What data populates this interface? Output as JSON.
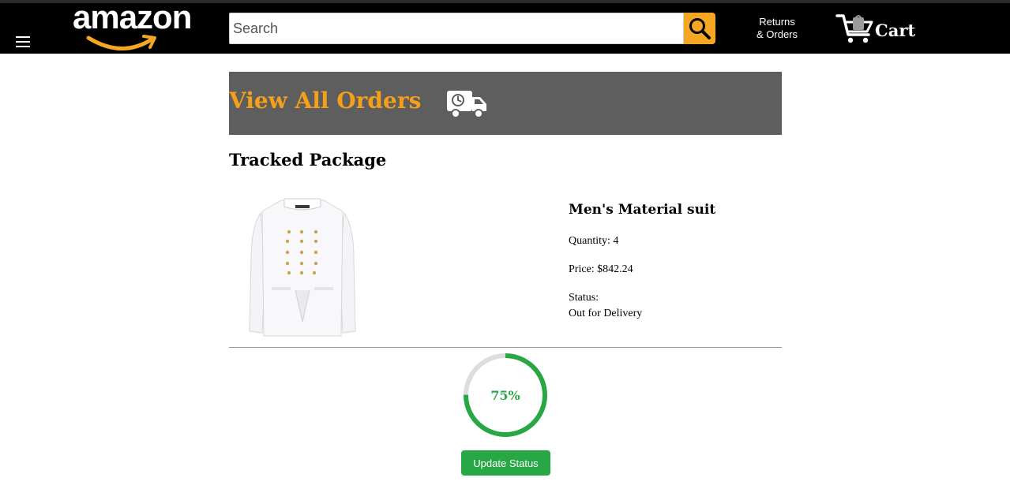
{
  "header": {
    "logo_text": "amazon",
    "search_placeholder": "Search",
    "search_value": "",
    "returns_line1": "Returns",
    "returns_line2": "& Orders",
    "cart_label": "Cart",
    "icons": {
      "menu": "hamburger-menu-icon",
      "search": "magnifier-icon",
      "cart": "shopping-cart-icon"
    },
    "colors": {
      "bar": "#000000",
      "search_button": "#f5a623",
      "logo_smile": "#f5a623"
    }
  },
  "orders_banner": {
    "title": "View All Orders",
    "icon": "delivery-truck-clock-icon",
    "colors": {
      "background": "#5e5e5e",
      "title": "#f5a01a"
    }
  },
  "section": {
    "title": "Tracked Package"
  },
  "product": {
    "image": "white-double-breasted-suit-jacket",
    "name": "Men's Material suit",
    "quantity_text": "Quantity: 4",
    "price_text": "Price: $842.24",
    "status_label": "Status:",
    "status_value": "Out for Delivery"
  },
  "progress": {
    "value": 0.75,
    "label": "75%",
    "color": "#28a745",
    "track_color": "#dddddd"
  },
  "actions": {
    "update_status_label": "Update Status"
  }
}
